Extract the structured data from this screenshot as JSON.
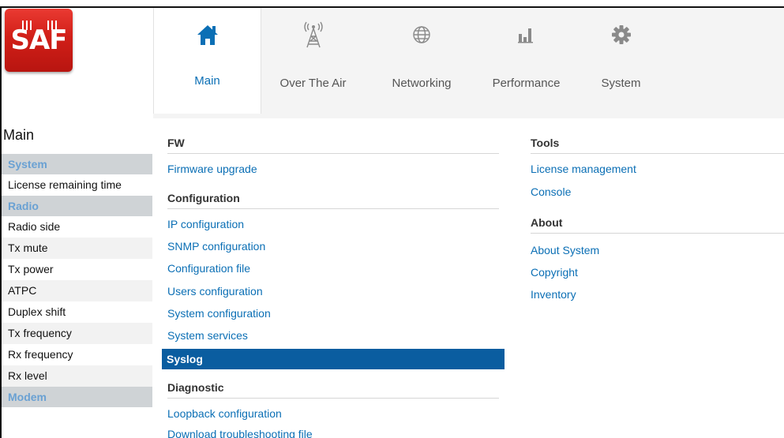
{
  "logo": {
    "text": "SAF"
  },
  "topnav": {
    "tabs": [
      {
        "label": "Main",
        "icon": "home-icon",
        "active": true
      },
      {
        "label": "Over The Air",
        "icon": "radio-tower-icon",
        "active": false
      },
      {
        "label": "Networking",
        "icon": "globe-icon",
        "active": false
      },
      {
        "label": "Performance",
        "icon": "bar-chart-icon",
        "active": false
      },
      {
        "label": "System",
        "icon": "gear-icon",
        "active": false
      }
    ]
  },
  "sidebar": {
    "title": "Main",
    "sections": [
      {
        "label": "System",
        "items": [
          "License remaining time"
        ]
      },
      {
        "label": "Radio",
        "items": [
          "Radio side",
          "Tx mute",
          "Tx power",
          "ATPC",
          "Duplex shift",
          "Tx frequency",
          "Rx frequency",
          "Rx level"
        ]
      },
      {
        "label": "Modem",
        "items": []
      }
    ]
  },
  "menu": {
    "left": {
      "groups": [
        {
          "heading": "FW",
          "links": [
            "Firmware upgrade"
          ]
        },
        {
          "heading": "Configuration",
          "links": [
            "IP configuration",
            "SNMP configuration",
            "Configuration file",
            "Users configuration",
            "System configuration",
            "System services",
            "Syslog"
          ]
        },
        {
          "heading": "Diagnostic",
          "links": [
            "Loopback configuration",
            "Download troubleshooting file"
          ]
        }
      ],
      "active_link": "Syslog"
    },
    "right": {
      "groups": [
        {
          "heading": "Tools",
          "links": [
            "License management",
            "Console"
          ]
        },
        {
          "heading": "About",
          "links": [
            "About System",
            "Copyright",
            "Inventory"
          ]
        }
      ]
    }
  },
  "colors": {
    "accent": "#0b6fb5",
    "active_bg": "#0a5da0",
    "logo_red": "#d11f18",
    "section_bg": "#cfd3d6",
    "section_text": "#6aa1d3"
  }
}
